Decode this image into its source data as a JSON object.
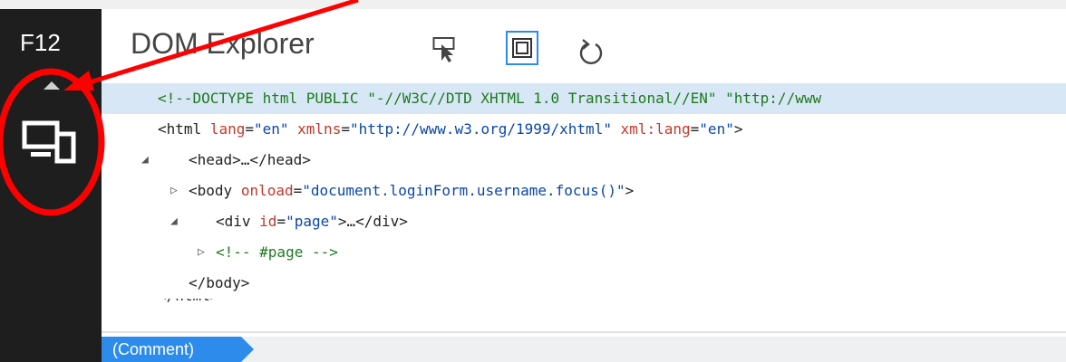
{
  "sidebar": {
    "f12_label": "F12"
  },
  "header": {
    "title": "DOM Explorer"
  },
  "tree": {
    "doctype": "<!--DOCTYPE html PUBLIC \"-//W3C//DTD XHTML 1.0 Transitional//EN\" \"http://www",
    "html_open": {
      "tag_open": "<html",
      "a1": "lang",
      "v1": "\"en\"",
      "a2": "xmlns",
      "v2": "\"http://www.w3.org/1999/xhtml\"",
      "a3": "xml:lang",
      "v3": "\"en\"",
      "tag_close": ">"
    },
    "head": "<head>…</head>",
    "body_open": {
      "tag_open": "<body",
      "a1": "onload",
      "v1": "\"document.loginForm.username.focus()\"",
      "tag_close": ">"
    },
    "div_page": {
      "tag_open": "<div",
      "a1": "id",
      "v1": "\"page\"",
      "tag_close": ">…</div>"
    },
    "comment_page": "<!-- #page -->",
    "body_close": "</body>"
  },
  "status": {
    "breadcrumb": "(Comment)"
  },
  "colors": {
    "sidebar_bg": "#1e1e1e",
    "selection_bg": "#d8e7f5",
    "accent": "#2d8ceb",
    "annotation_red": "#ff0000"
  }
}
